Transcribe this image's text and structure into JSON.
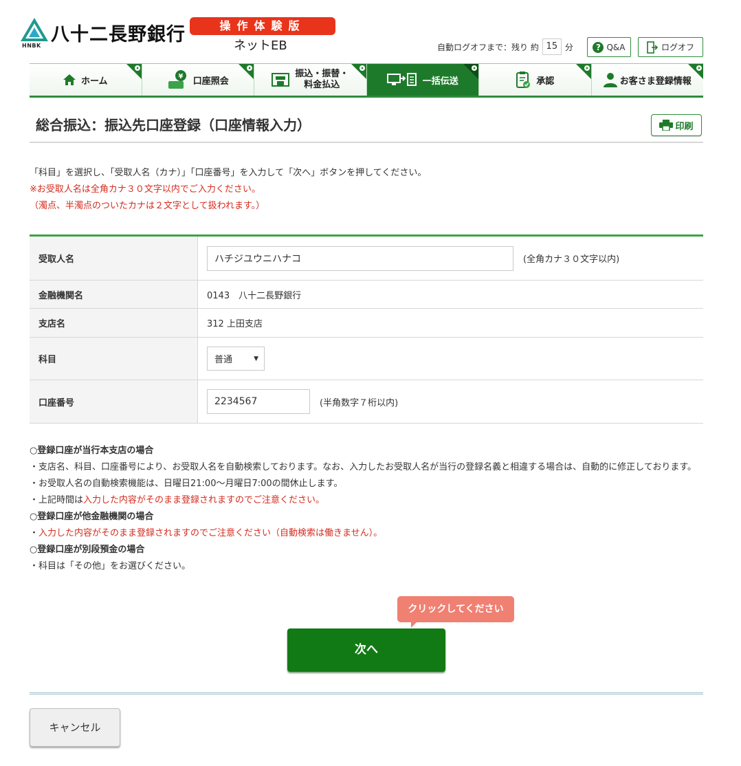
{
  "header": {
    "bank_name": "八十二長野銀行",
    "logo_sub": "HNBK",
    "trial_badge": "操作体験版",
    "product": "ネットEB",
    "autologoff_label": "自動ログオフまで：残り 約",
    "autologoff_minutes": "15",
    "autologoff_unit": "分",
    "qa_label": "Q&A",
    "logoff_label": "ログオフ"
  },
  "nav": {
    "home": "ホーム",
    "account": "口座照会",
    "transfer_line1": "振込・振替・",
    "transfer_line2": "料金払込",
    "bulk": "一括伝送",
    "approve": "承認",
    "customer": "お客さま登録情報"
  },
  "page": {
    "title": "総合振込：振込先口座登録（口座情報入力）",
    "print_label": "印刷",
    "instr1": "「科目」を選択し、「受取人名（カナ）」「口座番号」を入力して「次へ」ボタンを押してください。",
    "instr2": "※お受取人名は全角カナ３０文字以内でご入力ください。",
    "instr3": "（濁点、半濁点のついたカナは２文字として扱われます。）"
  },
  "form": {
    "payee_label": "受取人名",
    "payee_value": "ハチジユウニハナコ",
    "payee_hint": "(全角カナ３０文字以内)",
    "bank_label": "金融機関名",
    "bank_value": "0143　八十二長野銀行",
    "branch_label": "支店名",
    "branch_value": "312 上田支店",
    "subject_label": "科目",
    "subject_value": "普通",
    "account_label": "口座番号",
    "account_value": "2234567",
    "account_hint": "(半角数字７桁以内)"
  },
  "notes": {
    "h1": "○登録口座が当行本支店の場合",
    "n1": "・支店名、科目、口座番号により、お受取人名を自動検索しております。なお、入力したお受取人名が当行の登録名義と相違する場合は、自動的に修正しております。",
    "n2": "・お受取人名の自動検索機能は、日曜日21:00～月曜日7:00の間休止します。",
    "n3_prefix": "・上記時間は",
    "n3_red": "入力した内容がそのまま登録されますのでご注意ください。",
    "h2": "○登録口座が他金融機関の場合",
    "n4_prefix": "・",
    "n4_red": "入力した内容がそのまま登録されますのでご注意ください（自動検索は働きません）。",
    "h3": "○登録口座が別段預金の場合",
    "n5": "・科目は「その他」をお選びください。"
  },
  "actions": {
    "tooltip": "クリックしてください",
    "next": "次へ",
    "cancel": "キャンセル"
  },
  "colors": {
    "brand_green": "#1e7a2b",
    "accent_red": "#d52b1e",
    "tooltip": "#f08072"
  }
}
